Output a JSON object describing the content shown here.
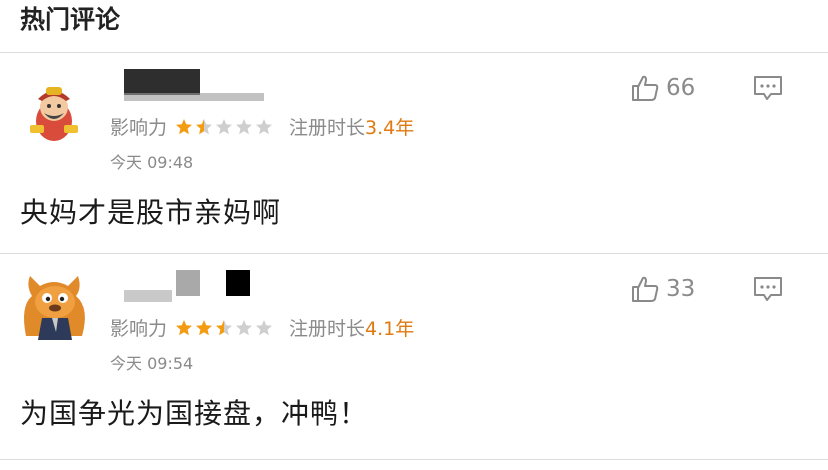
{
  "section": {
    "title": "热门评论"
  },
  "comments": [
    {
      "influence_label": "影响力",
      "stars": 1.5,
      "reg_label": "注册时长",
      "reg_value": "3.4年",
      "time": "今天 09:48",
      "content": "央妈才是股市亲妈啊",
      "likes": "66"
    },
    {
      "influence_label": "影响力",
      "stars": 2.5,
      "reg_label": "注册时长",
      "reg_value": "4.1年",
      "time": "今天 09:54",
      "content": "为国争光为国接盘，冲鸭！",
      "likes": "33"
    }
  ],
  "colors": {
    "star_on": "#f39c12",
    "star_off": "#cfcfcf",
    "reg_value": "#e07a10"
  }
}
